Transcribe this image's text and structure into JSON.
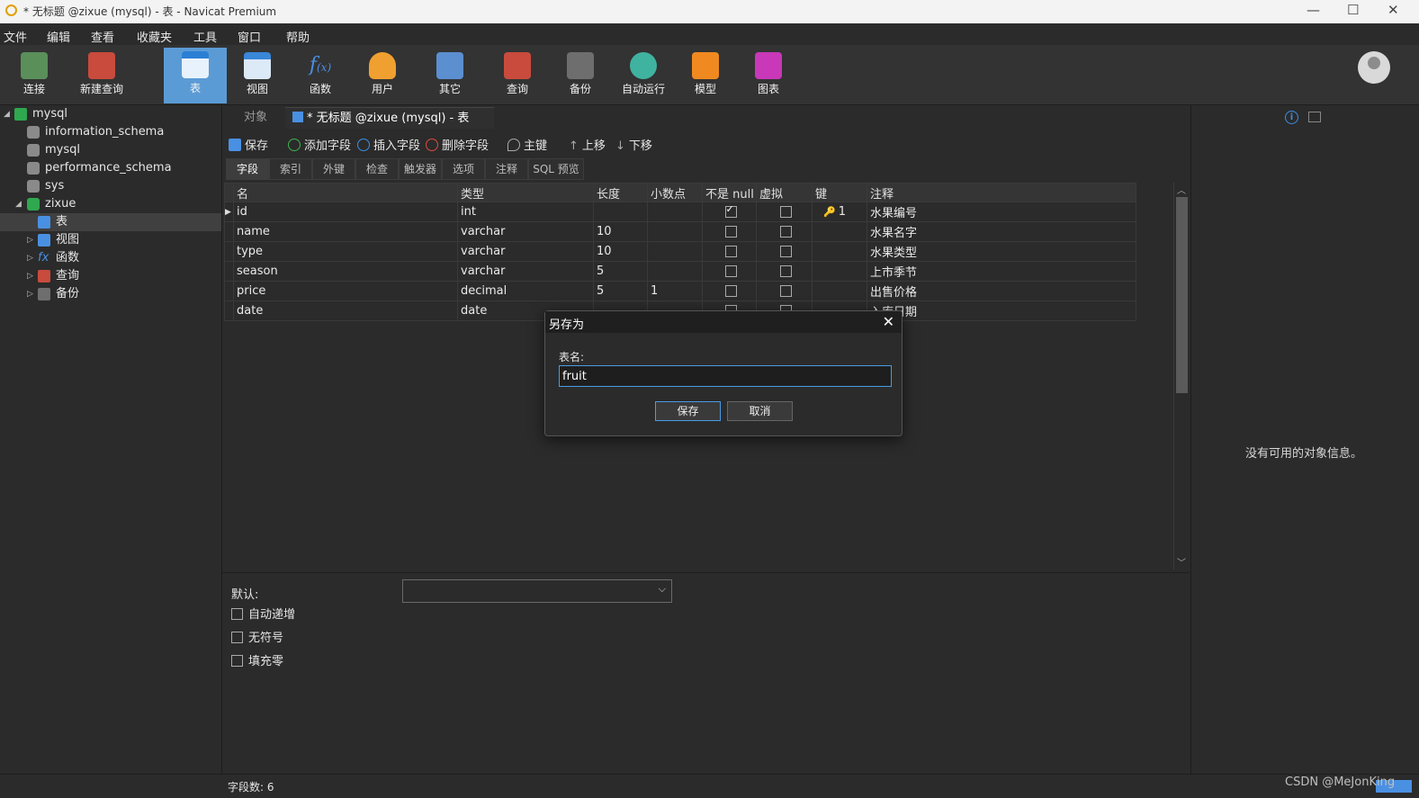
{
  "window": {
    "title": "* 无标题 @zixue (mysql) - 表 - Navicat Premium"
  },
  "menu": [
    "文件",
    "编辑",
    "查看",
    "收藏夹",
    "工具",
    "窗口",
    "帮助"
  ],
  "toolbar": {
    "items": [
      {
        "label": "连接",
        "icon": "connect-icon",
        "color": "#7fbf7f"
      },
      {
        "label": "新建查询",
        "icon": "new-query-icon",
        "color": "#e05a4a"
      },
      {
        "label": "表",
        "icon": "table-icon",
        "color": "#4a90e2"
      },
      {
        "label": "视图",
        "icon": "view-icon",
        "color": "#4a90e2"
      },
      {
        "label": "函数",
        "icon": "function-icon",
        "color": "#4a90e2"
      },
      {
        "label": "用户",
        "icon": "user-icon",
        "color": "#f0a030"
      },
      {
        "label": "其它",
        "icon": "tools-icon",
        "color": "#6a9fd8"
      },
      {
        "label": "查询",
        "icon": "query-icon",
        "color": "#e05a4a"
      },
      {
        "label": "备份",
        "icon": "backup-icon",
        "color": "#8a8a8a"
      },
      {
        "label": "自动运行",
        "icon": "robot-icon",
        "color": "#3fb3a0"
      },
      {
        "label": "模型",
        "icon": "model-icon",
        "color": "#f08a20"
      },
      {
        "label": "图表",
        "icon": "chart-icon",
        "color": "#d040c0"
      }
    ],
    "active_index": 2
  },
  "tree": {
    "connection": "mysql",
    "databases": [
      "information_schema",
      "mysql",
      "performance_schema",
      "sys",
      "zixue"
    ],
    "zixue_children": [
      "表",
      "视图",
      "函数",
      "查询",
      "备份"
    ]
  },
  "tabs": {
    "objects": "对象",
    "active": "* 无标题 @zixue (mysql) - 表"
  },
  "editor_tools": {
    "save": "保存",
    "add_field": "添加字段",
    "insert_field": "插入字段",
    "delete_field": "删除字段",
    "primary_key": "主键",
    "move_up": "上移",
    "move_down": "下移"
  },
  "subtabs": [
    "字段",
    "索引",
    "外键",
    "检查",
    "触发器",
    "选项",
    "注释",
    "SQL 预览"
  ],
  "grid": {
    "headers": [
      "名",
      "类型",
      "长度",
      "小数点",
      "不是 null",
      "虚拟",
      "键",
      "注释"
    ],
    "rows": [
      {
        "name": "id",
        "type": "int",
        "length": "",
        "decimals": "",
        "not_null": true,
        "virtual": false,
        "key": "1",
        "comment": "水果编号"
      },
      {
        "name": "name",
        "type": "varchar",
        "length": "10",
        "decimals": "",
        "not_null": false,
        "virtual": false,
        "key": "",
        "comment": "水果名字"
      },
      {
        "name": "type",
        "type": "varchar",
        "length": "10",
        "decimals": "",
        "not_null": false,
        "virtual": false,
        "key": "",
        "comment": "水果类型"
      },
      {
        "name": "season",
        "type": "varchar",
        "length": "5",
        "decimals": "",
        "not_null": false,
        "virtual": false,
        "key": "",
        "comment": "上市季节"
      },
      {
        "name": "price",
        "type": "decimal",
        "length": "5",
        "decimals": "1",
        "not_null": false,
        "virtual": false,
        "key": "",
        "comment": "出售价格"
      },
      {
        "name": "date",
        "type": "date",
        "length": "",
        "decimals": "",
        "not_null": false,
        "virtual": false,
        "key": "",
        "comment": "入库日期"
      }
    ]
  },
  "props": {
    "default_label": "默认:",
    "auto_increment": "自动递增",
    "unsigned": "无符号",
    "zerofill": "填充零"
  },
  "right_panel": {
    "message": "没有可用的对象信息。"
  },
  "status": {
    "field_count": "字段数: 6"
  },
  "watermark": "CSDN @MeJonKing",
  "dialog": {
    "title": "另存为",
    "label": "表名:",
    "value": "fruit",
    "save": "保存",
    "cancel": "取消"
  }
}
